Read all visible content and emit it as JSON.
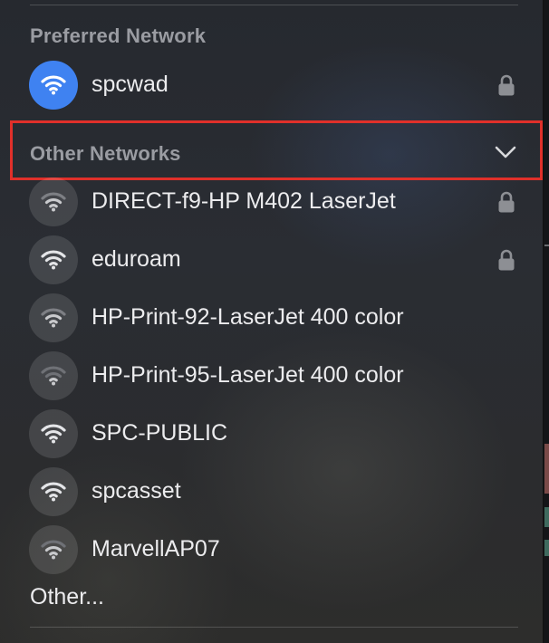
{
  "preferred": {
    "header": "Preferred Network",
    "network": {
      "name": "spcwad",
      "secured": true,
      "connected": true
    }
  },
  "other": {
    "header": "Other Networks",
    "networks": [
      {
        "name": "DIRECT-f9-HP M402 LaserJet",
        "secured": true
      },
      {
        "name": "eduroam",
        "secured": true
      },
      {
        "name": "HP-Print-92-LaserJet 400 color",
        "secured": false
      },
      {
        "name": "HP-Print-95-LaserJet 400 color",
        "secured": false
      },
      {
        "name": "SPC-PUBLIC",
        "secured": false
      },
      {
        "name": "spcasset",
        "secured": false
      },
      {
        "name": "MarvellAP07",
        "secured": false
      }
    ],
    "more_label": "Other..."
  },
  "icons": {
    "wifi": "wifi-icon",
    "lock": "lock-icon",
    "expand": "chevron-down-icon"
  },
  "colors": {
    "active_network": "#3f82f1",
    "highlight_box": "#e0302a"
  }
}
